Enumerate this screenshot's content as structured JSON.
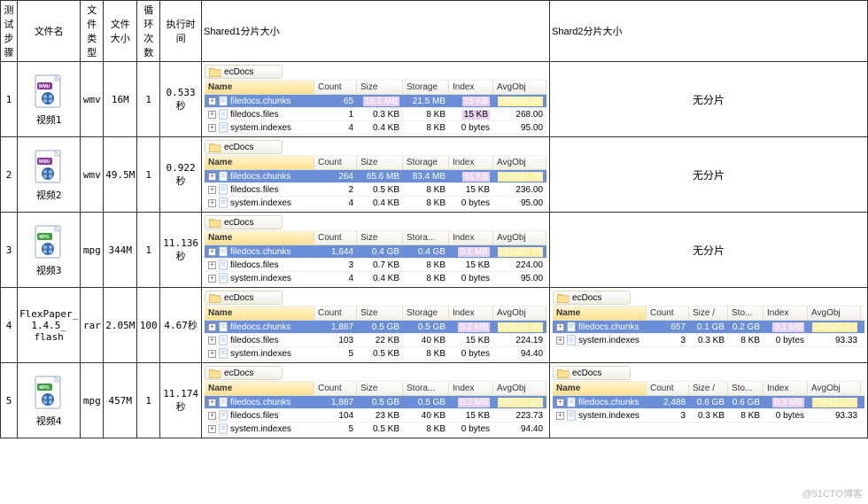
{
  "headers": {
    "step": "测试\n步骤",
    "fname": "文件名",
    "ftype": "文件\n类型",
    "fsize": "文件\n大小",
    "loop": "循环\n次数",
    "exec": "执行时间",
    "s1": "Shared1分片大小",
    "s2": "Shard2分片大小"
  },
  "folder_label": "ecDocs",
  "grid_headers": {
    "name": "Name",
    "count": "Count",
    "size": "Size",
    "storage": "Storage",
    "stora": "Stora...",
    "sto": "Sto...",
    "size_slash": "Size /",
    "index": "Index",
    "avg": "AvgObj"
  },
  "no_shard": "无分片",
  "watermark": "@51CTO博客",
  "rows": [
    {
      "step": "1",
      "file": {
        "label": "视频1",
        "type": "wmv",
        "icon_tag": "WMU",
        "icon_color": "#8a3a9e"
      },
      "ftype": "wmv",
      "fsize": "16M",
      "loop": "1",
      "exec": "0.533秒",
      "s1": {
        "items": [
          {
            "name": "filedocs.chunks",
            "sel": true,
            "count": "65",
            "size": "16.1 MB",
            "size_hl": true,
            "storage": "21.5 MB",
            "index": "15 KB",
            "index_hl": true,
            "avg": "259809.85",
            "avg_hl": true
          },
          {
            "name": "filedocs.files",
            "count": "1",
            "size": "0.3 KB",
            "storage": "8 KB",
            "index": "15 KB",
            "index_hl": true,
            "avg": "268.00"
          },
          {
            "name": "system.indexes",
            "count": "4",
            "size": "0.4 KB",
            "storage": "8 KB",
            "index": "0 bytes",
            "avg": "95.00"
          }
        ]
      },
      "s2": null
    },
    {
      "step": "2",
      "file": {
        "label": "视频2",
        "type": "wmv",
        "icon_tag": "WMU",
        "icon_color": "#8a3a9e"
      },
      "ftype": "wmv",
      "fsize": "49.5M",
      "loop": "1",
      "exec": "0.922秒",
      "s1": {
        "items": [
          {
            "name": "filedocs.chunks",
            "sel": true,
            "count": "264",
            "size": "65.6 MB",
            "storage": "83.4 MB",
            "index": "31 KB",
            "index_hl": true,
            "avg": "260631.29",
            "avg_hl": true
          },
          {
            "name": "filedocs.files",
            "count": "2",
            "size": "0.5 KB",
            "storage": "8 KB",
            "index": "15 KB",
            "avg": "236.00"
          },
          {
            "name": "system.indexes",
            "count": "4",
            "size": "0.4 KB",
            "storage": "8 KB",
            "index": "0 bytes",
            "avg": "95.00"
          }
        ]
      },
      "s2": null
    },
    {
      "step": "3",
      "file": {
        "label": "视频3",
        "type": "mpg",
        "icon_tag": "MPG",
        "icon_color": "#3aa03a"
      },
      "ftype": "mpg",
      "fsize": "344M",
      "loop": "1",
      "exec": "11.136秒",
      "s1": {
        "storage_header": "stora",
        "items": [
          {
            "name": "filedocs.chunks",
            "sel": true,
            "count": "1,644",
            "size": "0.4 GB",
            "storage": "0.4 GB",
            "index": "0.1 MB",
            "index_hl": true,
            "avg": "261912.78",
            "avg_hl": true
          },
          {
            "name": "filedocs.files",
            "count": "3",
            "size": "0.7 KB",
            "storage": "8 KB",
            "index": "15 KB",
            "avg": "224.00"
          },
          {
            "name": "system.indexes",
            "count": "4",
            "size": "0.4 KB",
            "storage": "8 KB",
            "index": "0 bytes",
            "avg": "95.00"
          }
        ]
      },
      "s2": null
    },
    {
      "step": "4",
      "file": {
        "label": "FlexPaper_1.4.5_flash",
        "type": "rar",
        "plain": true
      },
      "ftype": "rar",
      "fsize": "2.05M",
      "loop": "100",
      "exec": "4.67秒",
      "s1": {
        "items": [
          {
            "name": "filedocs.chunks",
            "sel": true,
            "count": "1,887",
            "size": "0.5 GB",
            "storage": "0.5 GB",
            "index": "0.2 MB",
            "index_hl": true,
            "avg": "259031.06",
            "avg_hl": true
          },
          {
            "name": "filedocs.files",
            "count": "103",
            "size": "22 KB",
            "storage": "40 KB",
            "index": "15 KB",
            "avg": "224.19"
          },
          {
            "name": "system.indexes",
            "count": "5",
            "size": "0.5 KB",
            "storage": "8 KB",
            "index": "0 bytes",
            "avg": "94.40"
          }
        ]
      },
      "s2": {
        "compact": true,
        "items": [
          {
            "name": "filedocs.chunks",
            "sel": true,
            "count": "657",
            "size": "0.1 GB",
            "storage": "0.2 GB",
            "index": "0.1 MB",
            "index_hl": true,
            "avg": "239515.12",
            "avg_hl": true
          },
          {
            "name": "system.indexes",
            "count": "3",
            "size": "0.3 KB",
            "storage": "8 KB",
            "index": "0 bytes",
            "avg": "93.33"
          }
        ]
      }
    },
    {
      "step": "5",
      "file": {
        "label": "视频4",
        "type": "mpg",
        "icon_tag": "MPG",
        "icon_color": "#3aa03a"
      },
      "ftype": "mpg",
      "fsize": "457M",
      "loop": "1",
      "exec": "11.174秒",
      "s1": {
        "storage_header": "stor",
        "items": [
          {
            "name": "filedocs.chunks",
            "sel": true,
            "count": "1,887",
            "size": "0.5 GB",
            "storage": "0.5 GB",
            "index": "0.2 MB",
            "index_hl": true,
            "avg": "259031.06",
            "avg_hl": true
          },
          {
            "name": "filedocs.files",
            "count": "104",
            "size": "23 KB",
            "storage": "40 KB",
            "index": "15 KB",
            "avg": "223.73"
          },
          {
            "name": "system.indexes",
            "count": "5",
            "size": "0.5 KB",
            "storage": "8 KB",
            "index": "0 bytes",
            "avg": "94.40"
          }
        ]
      },
      "s2": {
        "compact": true,
        "items": [
          {
            "name": "filedocs.chunks",
            "sel": true,
            "count": "2,488",
            "size": "0.6 GB",
            "storage": "0.6 GB",
            "index": "0.3 MB",
            "index_hl": true,
            "avg": "256190.25",
            "avg_hl": true
          },
          {
            "name": "system.indexes",
            "count": "3",
            "size": "0.3 KB",
            "storage": "8 KB",
            "index": "0 bytes",
            "avg": "93.33"
          }
        ]
      }
    }
  ]
}
